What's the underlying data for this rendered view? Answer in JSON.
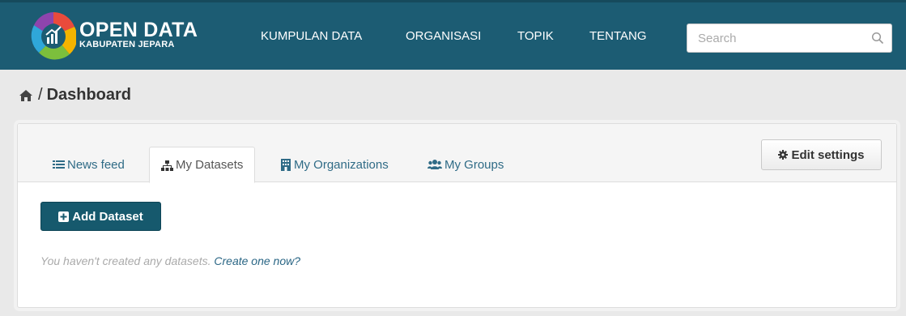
{
  "header": {
    "logo_icon": "open-data-logo",
    "logo_title": "OPEN DATA",
    "logo_subtitle": "KABUPATEN JEPARA",
    "nav": [
      {
        "label": "KUMPULAN DATA"
      },
      {
        "label": "ORGANISASI"
      },
      {
        "label": "TOPIK"
      },
      {
        "label": "TENTANG"
      }
    ],
    "search": {
      "placeholder": "Search",
      "icon": "search-icon"
    }
  },
  "breadcrumb": {
    "home_icon": "home-icon",
    "separator": "/",
    "current": "Dashboard"
  },
  "tabs": [
    {
      "label": "News feed",
      "icon": "list-icon"
    },
    {
      "label": "My Datasets",
      "icon": "sitemap-icon",
      "active": true
    },
    {
      "label": "My Organizations",
      "icon": "building-icon"
    },
    {
      "label": "My Groups",
      "icon": "users-icon"
    }
  ],
  "edit_settings": {
    "label": "Edit settings",
    "icon": "gear-icon"
  },
  "add_dataset": {
    "label": "Add Dataset",
    "icon": "plus-square-icon"
  },
  "empty_message": {
    "text": "You haven't created any datasets.",
    "link": "Create one now?"
  },
  "colors": {
    "header_bg": "#1c5c73",
    "accent": "#16596d",
    "link": "#2f6b86",
    "page_bg": "#e9e9e9"
  }
}
